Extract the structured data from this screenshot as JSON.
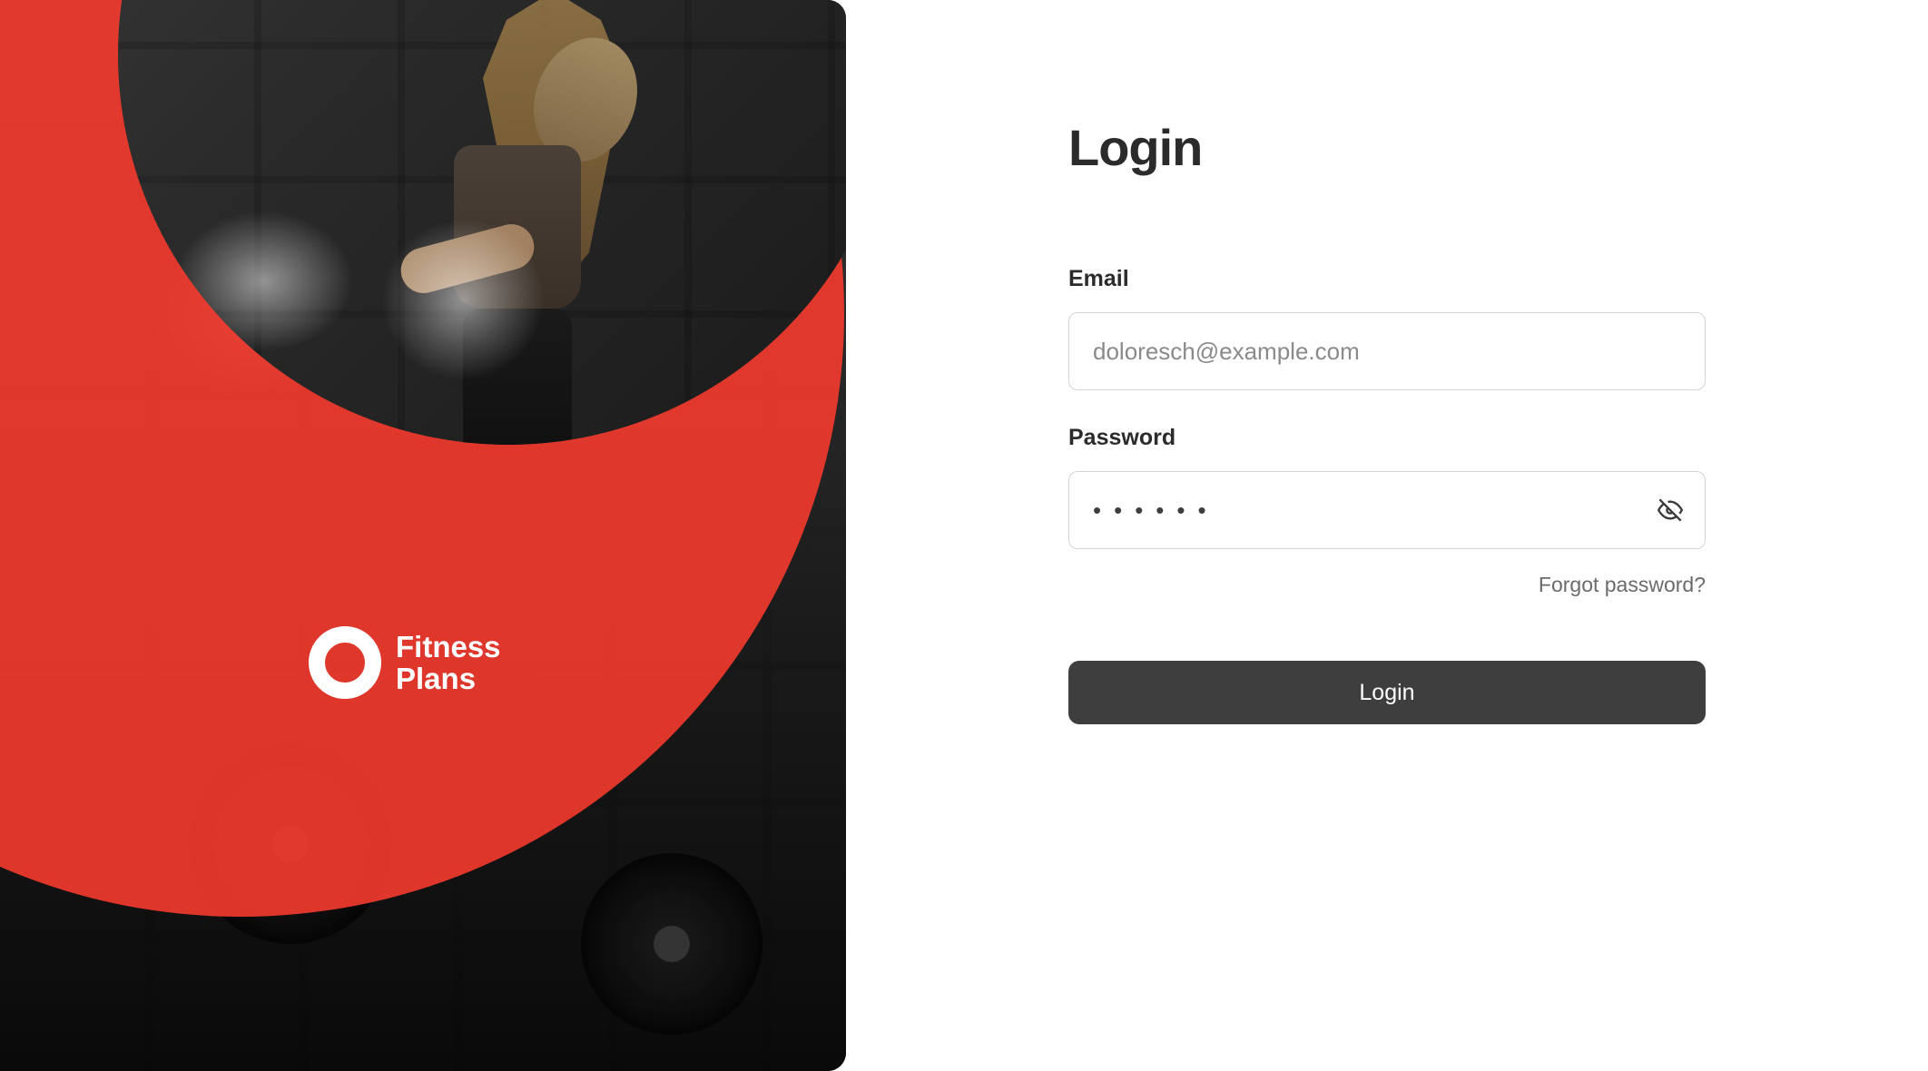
{
  "brand": {
    "line1": "Fitness",
    "line2": "Plans"
  },
  "login": {
    "title": "Login",
    "email_label": "Email",
    "email_placeholder": "doloresch@example.com",
    "email_value": "",
    "password_label": "Password",
    "password_value": "••••••",
    "forgot_label": "Forgot password?",
    "submit_label": "Login"
  },
  "colors": {
    "accent": "#f03a2d",
    "button_bg": "#3e3e3e",
    "text_dark": "#2b2b2b",
    "border": "#d4d4d4"
  },
  "icons": {
    "brand_logo": "ring-icon",
    "password_toggle": "eye-off-icon"
  }
}
